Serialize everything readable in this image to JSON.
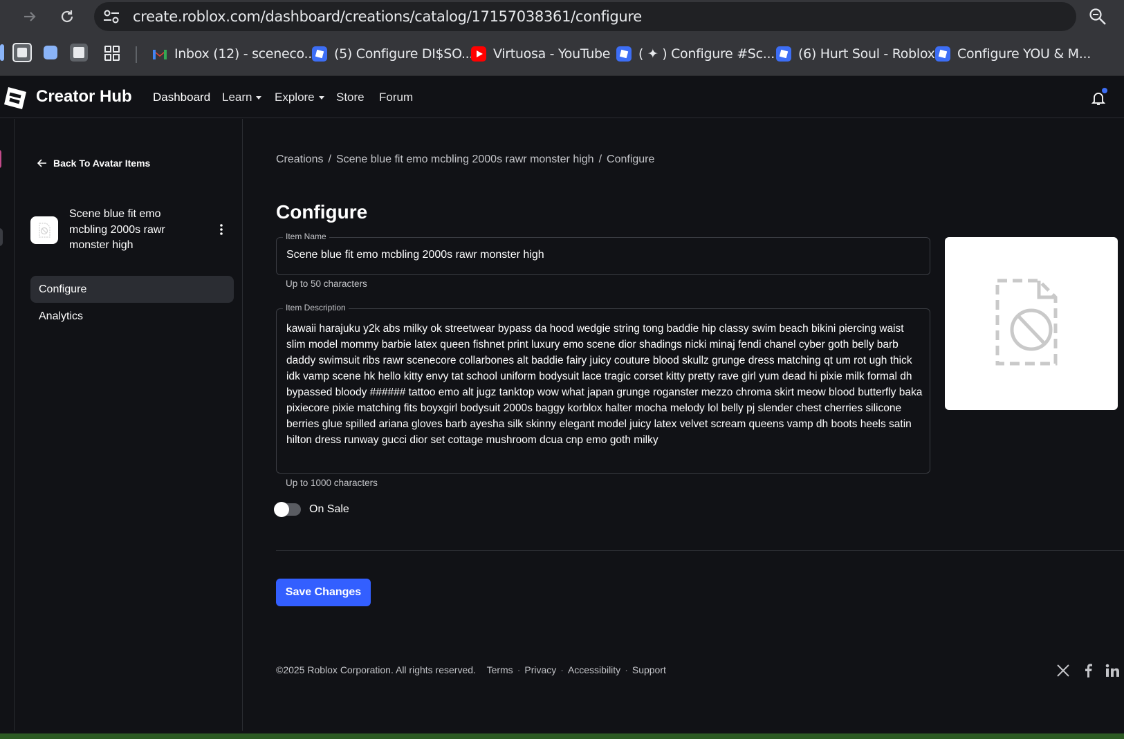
{
  "browser": {
    "url": "create.roblox.com/dashboard/creations/catalog/17157038361/configure",
    "bookmarks": [
      {
        "label": "Inbox (12) - sceneco...",
        "icon": "gmail-icon"
      },
      {
        "label": "(5) Configure DI$SO...",
        "icon": "roblox-icon"
      },
      {
        "label": "Virtuosa - YouTube",
        "icon": "youtube-icon"
      },
      {
        "label": "( ✦ ) Configure #Sc...",
        "icon": "roblox-icon"
      },
      {
        "label": "(6) Hurt Soul - Roblox",
        "icon": "roblox-icon"
      },
      {
        "label": "Configure YOU & M...",
        "icon": "roblox-icon"
      }
    ]
  },
  "header": {
    "brand": "Creator Hub",
    "nav": [
      "Dashboard",
      "Learn",
      "Explore",
      "Store",
      "Forum"
    ]
  },
  "sidebar": {
    "back_label": "Back To Avatar Items",
    "item_title": "Scene blue fit emo mcbling 2000s rawr monster high",
    "menu": [
      {
        "label": "Configure",
        "active": true
      },
      {
        "label": "Analytics",
        "active": false
      }
    ]
  },
  "main": {
    "breadcrumb": [
      "Creations",
      "Scene blue fit emo mcbling 2000s rawr monster high",
      "Configure"
    ],
    "title": "Configure",
    "item_name": {
      "legend": "Item Name",
      "value": "Scene blue fit emo mcbling 2000s rawr monster high",
      "help": "Up to 50 characters"
    },
    "item_description": {
      "legend": "Item Description",
      "value": "kawaii harajuku y2k abs milky ok streetwear bypass da hood wedgie string tong baddie hip classy swim beach bikini piercing waist slim model mommy barbie latex queen fishnet print luxury emo scene dior shadings nicki minaj fendi chanel cyber goth belly barb daddy swimsuit ribs rawr scenecore collarbones alt baddie fairy juicy couture blood skullz grunge dress matching qt um rot ugh thick idk vamp scene hk hello kitty envy tat school uniform bodysuit lace tragic corset kitty pretty rave girl yum dead hi pixie milk formal dh bypassed bloody ###### tattoo emo alt jugz tanktop wow what japan grunge roganster mezzo chroma skirt meow blood butterfly baka pixiecore pixie matching fits boyxgirl bodysuit 2000s baggy korblox halter mocha melody lol belly pj slender chest cherries silicone berries glue spilled ariana gloves barb ayesha silk skinny elegant model juicy latex velvet scream queens vamp dh boots heels satin hilton dress runway gucci dior set cottage mushroom dcua cnp emo goth milky",
      "help": "Up to 1000 characters"
    },
    "on_sale": {
      "label": "On Sale",
      "enabled": false
    },
    "save_label": "Save Changes"
  },
  "footer": {
    "copyright": "©2025 Roblox Corporation. All rights reserved.",
    "links": [
      "Terms",
      "Privacy",
      "Accessibility",
      "Support"
    ],
    "social_icons": [
      "x-icon",
      "facebook-icon",
      "linkedin-icon"
    ]
  },
  "colors": {
    "background": "#111216",
    "accent": "#335fff",
    "chrome": "#35363a"
  }
}
